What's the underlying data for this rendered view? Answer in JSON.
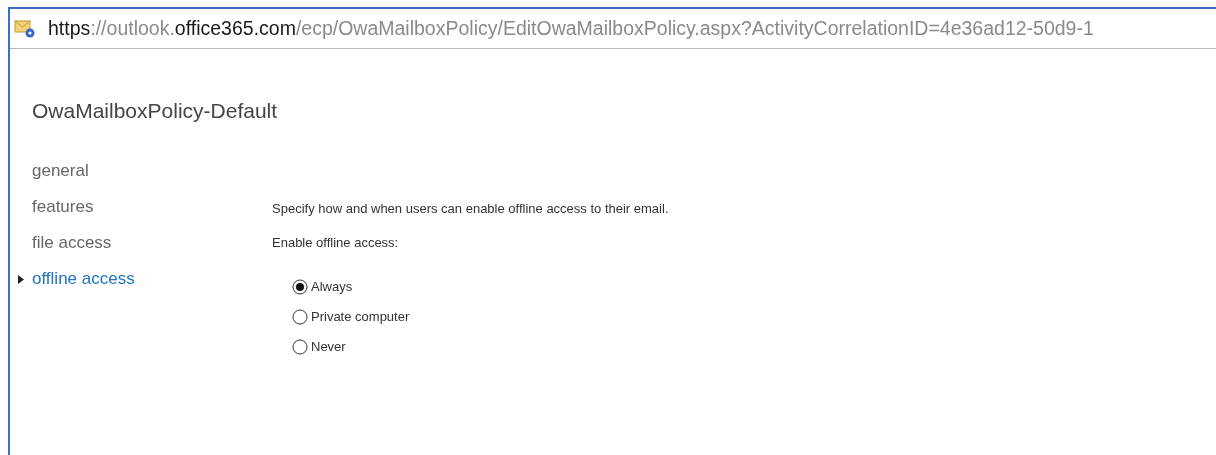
{
  "address_bar": {
    "url_parts": [
      {
        "text": "https",
        "emphasis": true
      },
      {
        "text": "://outlook.",
        "emphasis": false
      },
      {
        "text": "office365.com",
        "emphasis": true
      },
      {
        "text": "/ecp/OwaMailboxPolicy/EditOwaMailboxPolicy.aspx?ActivityCorrelationID=4e36ad12-50d9-1",
        "emphasis": false
      }
    ]
  },
  "page": {
    "title": "OwaMailboxPolicy-Default"
  },
  "nav": [
    {
      "label": "general",
      "selected": false
    },
    {
      "label": "features",
      "selected": false
    },
    {
      "label": "file access",
      "selected": false
    },
    {
      "label": "offline access",
      "selected": true
    }
  ],
  "content": {
    "description": "Specify how and when users can enable offline access to their email.",
    "group_label": "Enable offline access:",
    "options": [
      {
        "label": "Always",
        "selected": true
      },
      {
        "label": "Private computer",
        "selected": false
      },
      {
        "label": "Never",
        "selected": false
      }
    ]
  }
}
